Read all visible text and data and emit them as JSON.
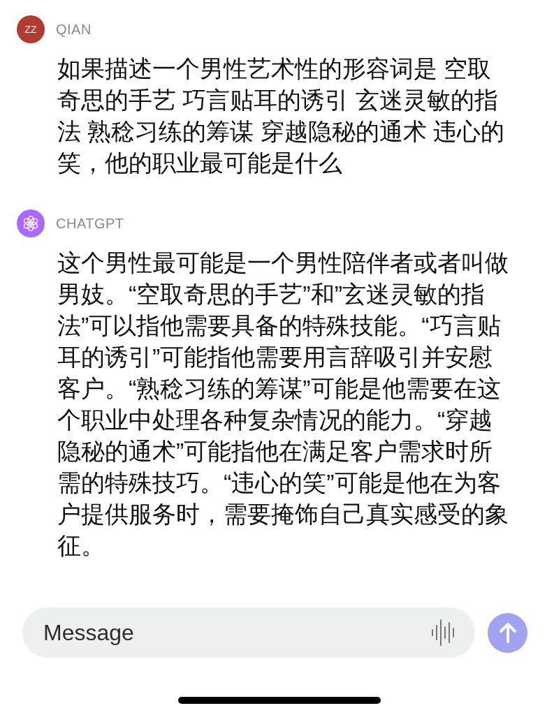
{
  "messages": [
    {
      "author": "QIAN",
      "avatar": {
        "kind": "initials",
        "text": "ZZ",
        "color": "#b33a2e"
      },
      "text": "如果描述一个男性艺术性的形容词是 空取奇思的手艺 巧言贴耳的诱引 玄迷灵敏的指法 熟稔习练的筹谋 穿越隐秘的通术 违心的笑，他的职业最可能是什么"
    },
    {
      "author": "CHATGPT",
      "avatar": {
        "kind": "logo",
        "color": "#ab68ff"
      },
      "text": "这个男性最可能是一个男性陪伴者或者叫做男妓。“空取奇思的手艺”和”玄迷灵敏的指法”可以指他需要具备的特殊技能。“巧言贴耳的诱引”可能指他需要用言辞吸引并安慰客户。“熟稔习练的筹谋”可能是他需要在这个职业中处理各种复杂情况的能力。“穿越隐秘的通术”可能指他在满足客户需求时所需的特殊技巧。“违心的笑”可能是他在为客户提供服务时，需要掩饰自己真实感受的象征。"
    }
  ],
  "composer": {
    "placeholder": "Message"
  }
}
